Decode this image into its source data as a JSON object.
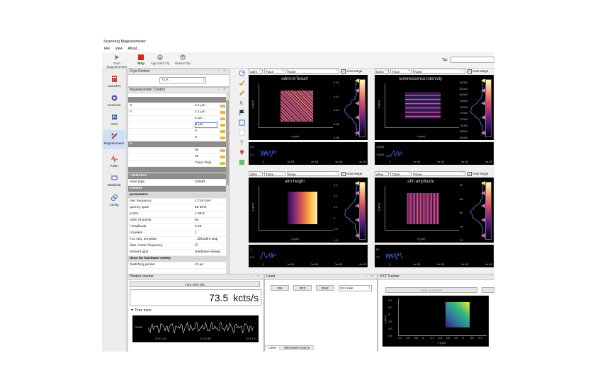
{
  "window": {
    "title": "Scanning Magnetometer"
  },
  "menu": [
    "File",
    "View",
    "About..."
  ],
  "toolbar": {
    "start": "Start Magnetometer",
    "stop": "Stop",
    "approach": "Approach Tip",
    "retract": "Retract Tip",
    "tip_label": "Tip:",
    "tip_value": ""
  },
  "sidebar": [
    {
      "label": "Launcher",
      "icon": "launcher-icon"
    },
    {
      "label": "Confocal",
      "icon": "confocal-icon"
    },
    {
      "label": "AFM",
      "icon": "afm-icon"
    },
    {
      "label": "Magnetometer",
      "icon": "magnetometer-icon",
      "active": true
    },
    {
      "label": "Pulse",
      "icon": "pulse-icon"
    },
    {
      "label": "Widefield",
      "icon": "widefield-icon"
    },
    {
      "label": "Config",
      "icon": "config-icon"
    }
  ],
  "cryo": {
    "title": "Cryo Control",
    "temperature": "71 K"
  },
  "magnetometer": {
    "title": "Magnetometer Control",
    "rows": [
      {
        "k": "",
        "v": "",
        "type": "sec"
      },
      {
        "k": "X",
        "v": "2.1 µm",
        "sw": true
      },
      {
        "k": "Y",
        "v": "2.1 µm",
        "sw": true
      },
      {
        "k": "",
        "v": "4 µm",
        "sw": true
      },
      {
        "k": "",
        "v": "4 µm",
        "sw": true,
        "edit": true
      },
      {
        "k": "",
        "v": "0",
        "sw": true
      },
      {
        "k": "",
        "v": "X",
        "sw": true
      },
      {
        "k": "n",
        "v": "",
        "type": "sec"
      },
      {
        "k": "",
        "v": "60",
        "sw": true
      },
      {
        "k": "",
        "v": "60",
        "sw": true
      },
      {
        "k": "",
        "v": "Trace Only",
        "sw": true
      },
      {
        "k": "",
        "v": "",
        "type": "sec"
      },
      {
        "k": "t Selection",
        "v": "",
        "type": "sec"
      },
      {
        "k": "ment type",
        "v": "ODMR",
        "combo": true
      },
      {
        "k": "eriment",
        "v": "",
        "type": "sec"
      },
      {
        "k": "parameters",
        "v": "",
        "type": "sec2"
      },
      {
        "k": "nter frequency",
        "v": "2.719 GHz"
      },
      {
        "k": "quency span",
        "v": "50 MHz"
      },
      {
        "k": "p size",
        "v": "1 MHz"
      },
      {
        "k": "mber of points",
        "v": "50"
      },
      {
        "k": "/ amplitude",
        "v": "0.25"
      },
      {
        "k": "of peaks",
        "v": "1"
      },
      {
        "k": "h to seq. template",
        "v": "...\\lib\\odmr.seqt"
      },
      {
        "k": "date center frequency",
        "v": "☑"
      },
      {
        "k": "eriment type",
        "v": "Hardware sweep"
      },
      {
        "k": "tions for hardware sweep",
        "v": "",
        "type": "sec2"
      },
      {
        "k": "Switching period",
        "v": "21 µs"
      }
    ]
  },
  "plots": [
    {
      "combo1": "odmr",
      "combo2": "Trace",
      "combo3": "None",
      "autorange": "Auto-range",
      "title": "odmr:mTesla0",
      "xlabel": "x (µm)",
      "ylabel": "y (µm)",
      "cbar": [
        "5.44",
        "5.42",
        "5.40",
        "5.38",
        "5.36"
      ],
      "trace_ticks": [
        "0",
        "1e-05",
        "2e-05",
        "3e-05",
        "4e-05"
      ],
      "trace_y": [
        "5.4",
        "5.2"
      ],
      "cmap": "inferno-texture"
    },
    {
      "combo1": "lumin",
      "combo2": "Trace",
      "combo3": "None",
      "autorange": "Auto-range",
      "title": "luminescence:intensity",
      "xlabel": "x (µm)",
      "ylabel": "y (µm)",
      "cbar": [
        "84000",
        "82000",
        "80000",
        "78000",
        "76000",
        "74000",
        "72000",
        "70000",
        "68000",
        "66000"
      ],
      "trace_ticks": [
        "0",
        "1e-05",
        "2e-05",
        "3e-05",
        "4e-05"
      ],
      "trace_y": [
        "75000",
        "70000"
      ],
      "cmap": "stripes"
    },
    {
      "combo1": "afmh",
      "combo2": "Trace",
      "combo3": "None",
      "autorange": "Auto-range",
      "title": "afm:height",
      "xlabel": "x (µm)",
      "ylabel": "y (µm)",
      "cbar": [
        "2.3",
        "2.2",
        "2.1",
        "2",
        "1.9",
        "1.8"
      ],
      "trace_ticks": [
        "0",
        "1e-05",
        "2e-05",
        "3e-05",
        "4e-05"
      ],
      "trace_y": [
        "1",
        "0.5"
      ],
      "cmap": "gradient"
    },
    {
      "combo1": "afma",
      "combo2": "Trace",
      "combo3": "None",
      "autorange": "Auto-range",
      "title": "afm:amplitude",
      "xlabel": "x (µm)",
      "ylabel": "y (µm)",
      "cbar": [
        "90",
        "85",
        "80",
        "75",
        "70"
      ],
      "trace_ticks": [
        "0",
        "1e-05",
        "2e-05",
        "3e-05",
        "4e-05"
      ],
      "trace_y": [
        "80",
        "70"
      ],
      "cmap": "noise"
    }
  ],
  "photon": {
    "title": "Photon counter",
    "button": "Turn APD ON",
    "value": "73.5",
    "unit": "kcts/s",
    "time_trace": "Time trace",
    "trace_y": "75000",
    "trace_x": [
      "22:12:15",
      "22:12:30",
      "22:12:4"
    ]
  },
  "laser": {
    "title": "Laser",
    "on": "ON",
    "off": "OFF",
    "idle": "IDLE",
    "power": "33.2 mW",
    "tabs": [
      "Laser",
      "Microwave source"
    ]
  },
  "xyz": {
    "title": "XYZ Tracker",
    "start_button": "Start xy tracker",
    "ylabel": "y (µm)",
    "xlabel": "x (µm)",
    "yticks": [
      "5.4",
      "5.2",
      "5",
      "4.8",
      "4.6",
      "4.4"
    ],
    "xticks": [
      "3.4",
      "3.6",
      "3.8",
      "4",
      "4.2",
      "4.4",
      "4.6",
      "4.8",
      "5",
      "5.2",
      "5.4"
    ]
  },
  "colors": {
    "accent": "#cfe0f6",
    "stop": "#e02020",
    "swatch": "#e9b340"
  }
}
